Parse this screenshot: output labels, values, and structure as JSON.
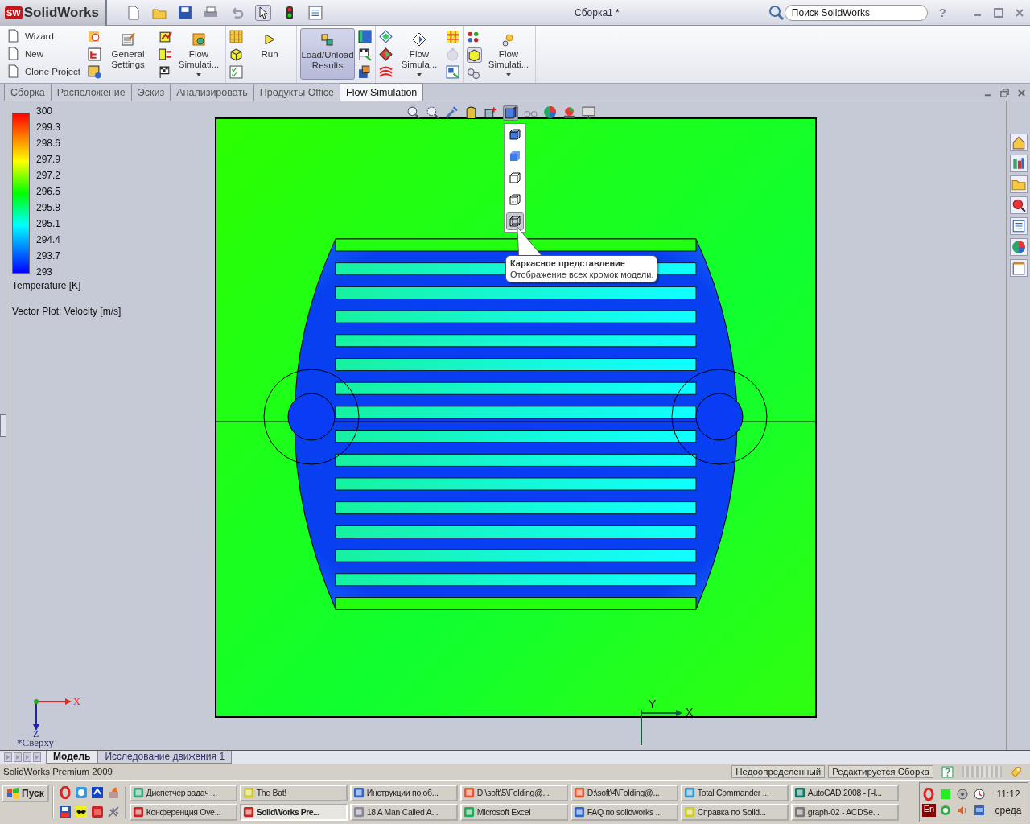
{
  "app": {
    "logo_mark": "SW",
    "logo": "SolidWorks",
    "title": "Сборка1 *",
    "search_placeholder": "Поиск SolidWorks",
    "help": "?"
  },
  "ribbon": [
    {
      "label": "Wizard",
      "pressed": false
    },
    {
      "label": "New",
      "pressed": false
    },
    {
      "label": "Clone Project",
      "pressed": false
    },
    {
      "label": "General Settings",
      "pressed": false
    },
    {
      "label": "Flow Simulati...",
      "pressed": false
    },
    {
      "label": "Run",
      "pressed": false
    },
    {
      "label": "Load/Unload Results",
      "pressed": true
    },
    {
      "label": "Flow Simula...",
      "pressed": false
    },
    {
      "label": "Flow Simulati...",
      "pressed": false
    }
  ],
  "tabs": [
    {
      "label": "Сборка",
      "selected": false
    },
    {
      "label": "Расположение",
      "selected": false
    },
    {
      "label": "Эскиз",
      "selected": false
    },
    {
      "label": "Анализировать",
      "selected": false
    },
    {
      "label": "Продукты Office",
      "selected": false
    },
    {
      "label": "Flow Simulation",
      "selected": true
    }
  ],
  "legend": {
    "ticks": [
      "300",
      "299.3",
      "298.6",
      "297.9",
      "297.2",
      "296.5",
      "295.8",
      "295.1",
      "294.4",
      "293.7",
      "293"
    ],
    "title": "Temperature [K]",
    "note": "Vector Plot: Velocity [m/s]"
  },
  "display_menu": [
    {
      "kind": "shaded-edges",
      "selected": false
    },
    {
      "kind": "shaded",
      "selected": false
    },
    {
      "kind": "hidden-removed",
      "selected": false
    },
    {
      "kind": "hidden-visible",
      "selected": false
    },
    {
      "kind": "wireframe",
      "selected": true
    }
  ],
  "tooltip": {
    "title": "Каркасное представление",
    "text": "Отображение всех кромок модели."
  },
  "viewport": {
    "triad_x": "X",
    "triad_z": "Z",
    "view_name": "*Сверху",
    "axis_y": "Y",
    "axis_x": "X"
  },
  "doc_tabs": [
    {
      "label": "Модель",
      "selected": true
    },
    {
      "label": "Исследование движения 1",
      "selected": false
    }
  ],
  "status": {
    "product": "SolidWorks Premium 2009",
    "state": "Недоопределенный",
    "mode": "Редактируется Сборка"
  },
  "taskbar": {
    "start": "Пуск",
    "tasks": [
      {
        "label": "Диспетчер задач ...",
        "active": false
      },
      {
        "label": "The Bat!",
        "active": false
      },
      {
        "label": "Инструкции по об...",
        "active": false
      },
      {
        "label": "D:\\soft\\5\\Folding@...",
        "active": false
      },
      {
        "label": "D:\\soft\\4\\Folding@...",
        "active": false
      },
      {
        "label": "Total Commander ...",
        "active": false
      },
      {
        "label": "AutoCAD 2008 - [Ч...",
        "active": false
      },
      {
        "label": "Конференция Ove...",
        "active": false
      },
      {
        "label": "SolidWorks Pre...",
        "active": true
      },
      {
        "label": "18 A Man Called A...",
        "active": false
      },
      {
        "label": "Microsoft Excel",
        "active": false
      },
      {
        "label": "FAQ по solidworks ...",
        "active": false
      },
      {
        "label": "Справка по Solid...",
        "active": false
      },
      {
        "label": "graph-02 - ACDSe...",
        "active": false
      }
    ],
    "language": "En",
    "time": "11:12",
    "day": "среда"
  }
}
